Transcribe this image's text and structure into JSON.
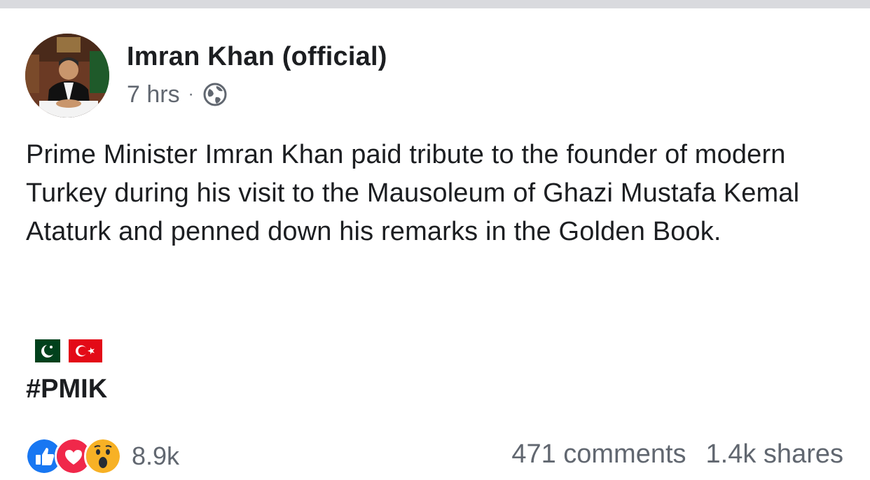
{
  "post": {
    "author": "Imran Khan (official)",
    "time": "7 hrs",
    "separator": "·",
    "privacy_icon": "globe-icon",
    "text": "Prime Minister Imran Khan paid tribute to the founder of modern Turkey during his visit to the Mausoleum of Ghazi Mustafa Kemal Ataturk and penned down his remarks in the Golden Book.",
    "flags": [
      "pakistan-flag-emoji",
      "turkey-flag-emoji"
    ],
    "hashtag": "#PMIK"
  },
  "footer": {
    "reaction_icons": [
      "like-icon",
      "love-icon",
      "wow-icon"
    ],
    "reaction_count": "8.9k",
    "comments": "471 comments",
    "shares": "1.4k shares"
  },
  "colors": {
    "text": "#1c1e21",
    "secondary": "#616770",
    "like_blue": "#1877f2",
    "love_red": "#f0284a",
    "wow_yellow": "#f7b125"
  }
}
